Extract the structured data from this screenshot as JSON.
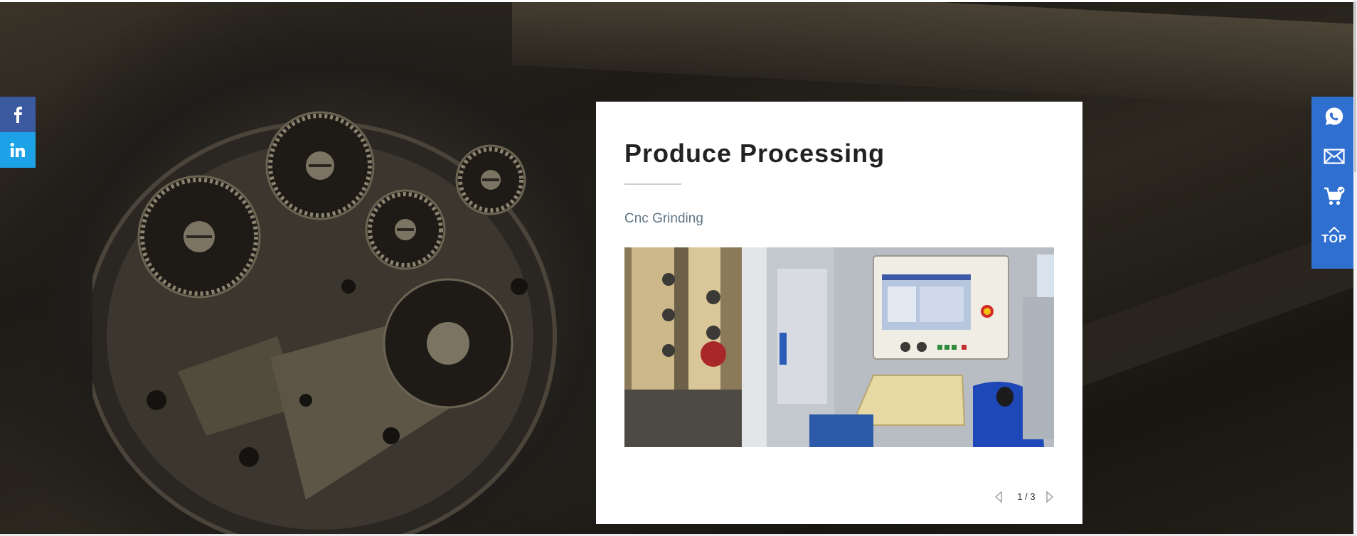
{
  "card": {
    "title": "Produce Processing",
    "subtitle": "Cnc Grinding",
    "pager": {
      "current": 1,
      "total": 3,
      "text": "1 / 3"
    }
  },
  "social": [
    {
      "name": "facebook",
      "icon": "facebook-icon",
      "glyph": "f",
      "color": "#3b5aa0"
    },
    {
      "name": "linkedin",
      "icon": "linkedin-icon",
      "glyph": "in",
      "color": "#1da2e8"
    }
  ],
  "right_rail": {
    "color": "#2f6fd0",
    "items": [
      {
        "name": "whatsapp",
        "icon": "whatsapp-icon"
      },
      {
        "name": "email",
        "icon": "email-icon"
      },
      {
        "name": "cart",
        "icon": "cart-icon"
      },
      {
        "name": "top",
        "icon": "chevron-up-icon",
        "label": "TOP"
      }
    ]
  },
  "colors": {
    "card_title": "#222222",
    "card_subtitle": "#5f7585",
    "divider": "#cccccc"
  }
}
